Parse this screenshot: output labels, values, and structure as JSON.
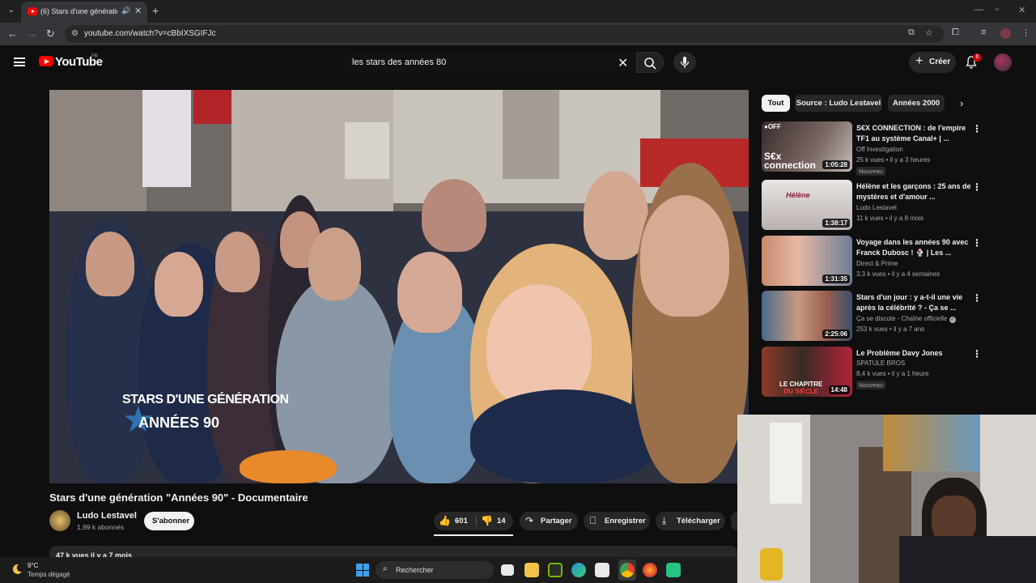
{
  "browser": {
    "tab_title": "(6) Stars d'une génération \"A",
    "url": "youtube.com/watch?v=cBbIXSGIFJc"
  },
  "masthead": {
    "logo_text": "YouTube",
    "country": "FR",
    "search_query": "les stars des années 80",
    "create_label": "Créer",
    "notification_count": "6"
  },
  "video": {
    "title": "Stars d'une génération \"Années 90\" - Documentaire",
    "overlay_line1": "STARS D'UNE GÉNÉRATION",
    "overlay_line2": "ANNÉES 90",
    "channel": "Ludo Lestavel",
    "subscribers": "1,99 k abonnés",
    "subscribe_label": "S'abonner",
    "likes": "601",
    "dislikes": "14",
    "share_label": "Partager",
    "save_label": "Enregistrer",
    "download_label": "Télécharger",
    "description_meta": "47 k vues  il y a 7 mois"
  },
  "sidebar": {
    "chips": [
      "Tout",
      "Source : Ludo Lestavel",
      "Années 2000"
    ],
    "recommendations": [
      {
        "title": "S€X CONNECTION : de l'empire TF1 au système Canal+ | ...",
        "channel": "Off Investigation",
        "meta": "25 k vues • il y a 3 heures",
        "badge": "Nouveau",
        "duration": "1:05:28"
      },
      {
        "title": "Hélène et les garçons : 25 ans de mystères et d'amour ...",
        "channel": "Ludo Lestavel",
        "meta": "11 k vues • il y a 8 mois",
        "badge": "",
        "duration": "1:38:17"
      },
      {
        "title": "Voyage dans les années 90 avec Franck Dubosc ! 🍨 | Les ...",
        "channel": "Direct & Prime",
        "meta": "3,3 k vues • il y a 4 semaines",
        "badge": "",
        "duration": "1:31:35"
      },
      {
        "title": "Stars d'un jour : y a-t-il une vie après la célébrité ? - Ça se ...",
        "channel": "Ça se discute - Chaîne officielle",
        "meta": "253 k vues • il y a 7 ans",
        "badge": "",
        "duration": "2:25:06"
      },
      {
        "title": "Le Problème Davy Jones",
        "channel": "SPATULE BROS",
        "meta": "8,4 k vues • il y a 1 heure",
        "badge": "Nouveau",
        "duration": "14:48"
      }
    ]
  },
  "taskbar": {
    "temperature": "9°C",
    "weather": "Temps dégagé",
    "search_placeholder": "Rechercher"
  }
}
